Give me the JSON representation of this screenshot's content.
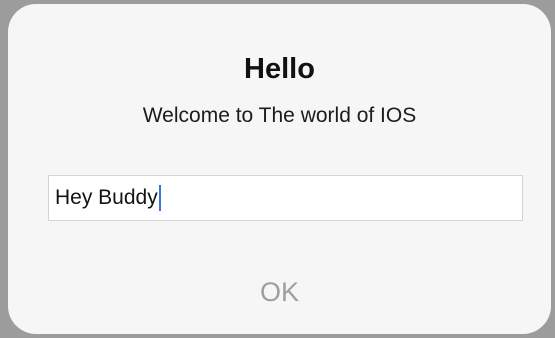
{
  "alert": {
    "title": "Hello",
    "message": "Welcome to The world of IOS",
    "text_field": {
      "value": "Hey Buddy"
    },
    "ok_button_label": "OK"
  },
  "colors": {
    "backdrop": "#9c9c9c",
    "alert_background": "#f6f6f6",
    "caret": "#3b74e0",
    "ok_button_text": "#9e9e9e"
  }
}
